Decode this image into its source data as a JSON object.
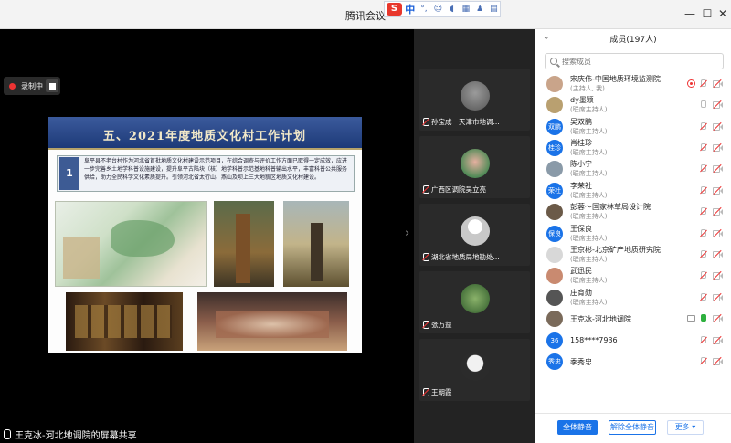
{
  "window": {
    "title": "腾讯会议"
  },
  "ime": {
    "logo": "S",
    "mode": "中"
  },
  "recording": {
    "label": "录制中"
  },
  "slide": {
    "title": "五、2021年度地质文化村工作计划",
    "number": "1",
    "body": "阜平县不老台村作为河北省首批地质文化村建设示范项目，在综合调查与评价工作方面已取得一定成效，应进一步完善乡土地学科普设施建设，提升阜平古陆块（核）地学科普示范基地科普输出水平，丰富科普公共服务供给，助力全民科学文化素质提升。引领河北省太行山、燕山及坝上三大地貌区地质文化村建设。"
  },
  "sharer": {
    "label": "王克冰-河北地调院的屏幕共享"
  },
  "thumbnails": [
    {
      "name": "孙宝成　天津市地调..."
    },
    {
      "name": "广西区调院吴立亮"
    },
    {
      "name": "湖北省地质局地勘处..."
    },
    {
      "name": "张万益"
    },
    {
      "name": "王朝霞"
    }
  ],
  "members_panel": {
    "header": "成员(197人)",
    "search_placeholder": "搜索成员",
    "members": [
      {
        "name": "宋庆伟-中国地质环境监测院",
        "role": "(主持人, 我)",
        "avatar_text": "",
        "avatar_color": "#c9a48a"
      },
      {
        "name": "dy墨颖",
        "role": "(联席主持人)",
        "avatar_text": "",
        "avatar_color": "#b9a070"
      },
      {
        "name": "吴双鹏",
        "role": "(联席主持人)",
        "avatar_text": "双鹏",
        "avatar_color": "#1a73e8"
      },
      {
        "name": "肖桂珍",
        "role": "(联席主持人)",
        "avatar_text": "桂珍",
        "avatar_color": "#1a73e8"
      },
      {
        "name": "陈小宁",
        "role": "(联席主持人)",
        "avatar_text": "",
        "avatar_color": "#8a9aa8"
      },
      {
        "name": "李荣社",
        "role": "(联席主持人)",
        "avatar_text": "荣社",
        "avatar_color": "#1a73e8"
      },
      {
        "name": "彭蓉～国家林草局设计院",
        "role": "(联席主持人)",
        "avatar_text": "",
        "avatar_color": "#6b5a48"
      },
      {
        "name": "王保良",
        "role": "(联席主持人)",
        "avatar_text": "保良",
        "avatar_color": "#1a73e8"
      },
      {
        "name": "王京彬-北京矿产地质研究院",
        "role": "(联席主持人)",
        "avatar_text": "",
        "avatar_color": "#d8d8d8"
      },
      {
        "name": "武迅民",
        "role": "(联席主持人)",
        "avatar_text": "",
        "avatar_color": "#c98a70"
      },
      {
        "name": "庄育勋",
        "role": "(联席主持人)",
        "avatar_text": "",
        "avatar_color": "#555555"
      },
      {
        "name": "王克冰-河北地调院",
        "role": "",
        "avatar_text": "",
        "avatar_color": "#7a6a5a"
      },
      {
        "name": "158****7936",
        "role": "",
        "avatar_text": "36",
        "avatar_color": "#1a73e8"
      },
      {
        "name": "季秀忠",
        "role": "",
        "avatar_text": "秀忠",
        "avatar_color": "#1a73e8"
      }
    ],
    "buttons": {
      "mute_all": "全体静音",
      "unmute_all": "解除全体静音",
      "more": "更多 ▾"
    }
  },
  "colors": {
    "accent": "#1a73e8",
    "record_red": "#e33333",
    "slide_banner": "#1d3a78"
  }
}
